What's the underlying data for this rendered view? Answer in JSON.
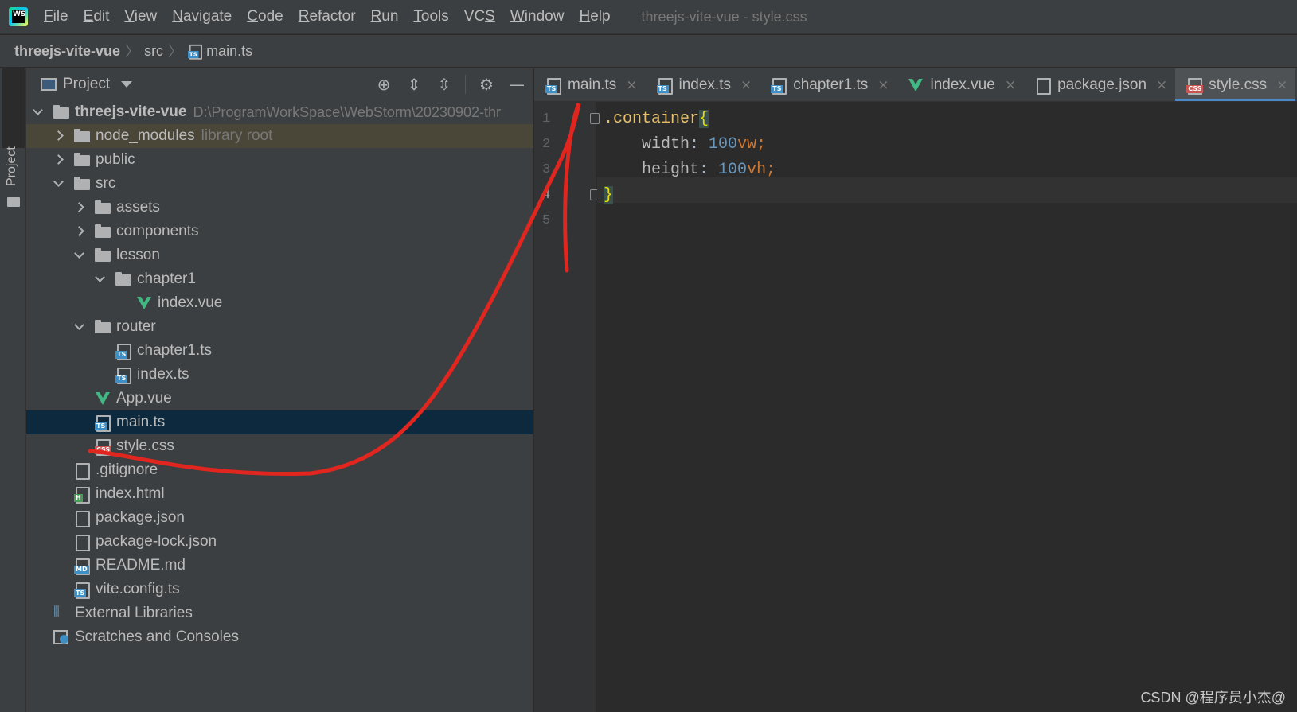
{
  "menubar": {
    "app_logo": "WS",
    "items": [
      {
        "pre": "",
        "u": "F",
        "post": "ile"
      },
      {
        "pre": "",
        "u": "E",
        "post": "dit"
      },
      {
        "pre": "",
        "u": "V",
        "post": "iew"
      },
      {
        "pre": "",
        "u": "N",
        "post": "avigate"
      },
      {
        "pre": "",
        "u": "C",
        "post": "ode"
      },
      {
        "pre": "",
        "u": "R",
        "post": "efactor"
      },
      {
        "pre": "",
        "u": "R",
        "post": "un"
      },
      {
        "pre": "",
        "u": "T",
        "post": "ools"
      },
      {
        "pre": "VC",
        "u": "S",
        "post": ""
      },
      {
        "pre": "",
        "u": "W",
        "post": "indow"
      },
      {
        "pre": "",
        "u": "H",
        "post": "elp"
      }
    ],
    "window_title": "threejs-vite-vue - style.css"
  },
  "breadcrumb": {
    "project": "threejs-vite-vue",
    "folder": "src",
    "file": "main.ts"
  },
  "toolstrip": {
    "project_label": "Project"
  },
  "project_panel": {
    "title": "Project",
    "tools": [
      "locate-icon",
      "expand-all-icon",
      "collapse-all-icon",
      "gear-icon",
      "minimize-icon"
    ],
    "tree": [
      {
        "label": "threejs-vite-vue",
        "extra": "D:\\ProgramWorkSpace\\WebStorm\\20230902-thr",
        "icon": "folder",
        "indent": 0,
        "chev": "down",
        "root": true
      },
      {
        "label": "node_modules",
        "extra": "library root",
        "icon": "folder",
        "indent": 1,
        "chev": "right",
        "state": "excluded"
      },
      {
        "label": "public",
        "icon": "folder",
        "indent": 1,
        "chev": "right"
      },
      {
        "label": "src",
        "icon": "folder",
        "indent": 1,
        "chev": "down"
      },
      {
        "label": "assets",
        "icon": "folder",
        "indent": 2,
        "chev": "right"
      },
      {
        "label": "components",
        "icon": "folder",
        "indent": 2,
        "chev": "right"
      },
      {
        "label": "lesson",
        "icon": "folder",
        "indent": 2,
        "chev": "down"
      },
      {
        "label": "chapter1",
        "icon": "folder",
        "indent": 3,
        "chev": "down"
      },
      {
        "label": "index.vue",
        "icon": "vue",
        "indent": 4,
        "chev": "none"
      },
      {
        "label": "router",
        "icon": "folder",
        "indent": 2,
        "chev": "down"
      },
      {
        "label": "chapter1.ts",
        "icon": "ts",
        "indent": 3,
        "chev": "none"
      },
      {
        "label": "index.ts",
        "icon": "ts",
        "indent": 3,
        "chev": "none"
      },
      {
        "label": "App.vue",
        "icon": "vue",
        "indent": 2,
        "chev": "none"
      },
      {
        "label": "main.ts",
        "icon": "ts",
        "indent": 2,
        "chev": "none",
        "state": "selected"
      },
      {
        "label": "style.css",
        "icon": "css",
        "indent": 2,
        "chev": "none"
      },
      {
        "label": ".gitignore",
        "icon": "file",
        "indent": 1,
        "chev": "none"
      },
      {
        "label": "index.html",
        "icon": "html",
        "indent": 1,
        "chev": "none"
      },
      {
        "label": "package.json",
        "icon": "file",
        "indent": 1,
        "chev": "none"
      },
      {
        "label": "package-lock.json",
        "icon": "file",
        "indent": 1,
        "chev": "none"
      },
      {
        "label": "README.md",
        "icon": "md",
        "indent": 1,
        "chev": "none"
      },
      {
        "label": "vite.config.ts",
        "icon": "ts",
        "indent": 1,
        "chev": "none"
      },
      {
        "label": "External Libraries",
        "icon": "libs",
        "indent": 0,
        "chev": "none"
      },
      {
        "label": "Scratches and Consoles",
        "icon": "scratch",
        "indent": 0,
        "chev": "none"
      }
    ]
  },
  "editor": {
    "tabs": [
      {
        "label": "main.ts",
        "icon": "ts"
      },
      {
        "label": "index.ts",
        "icon": "ts"
      },
      {
        "label": "chapter1.ts",
        "icon": "ts"
      },
      {
        "label": "index.vue",
        "icon": "vue"
      },
      {
        "label": "package.json",
        "icon": "file"
      },
      {
        "label": "style.css",
        "icon": "css",
        "active": true
      }
    ],
    "close_glyph": "×",
    "line_numbers": [
      "1",
      "2",
      "3",
      "4",
      "5"
    ],
    "current_line": 4,
    "code": {
      "selector": ".container",
      "open_brace": "{",
      "prop1": "width",
      "val1_num": "100",
      "val1_unit": "vw",
      "prop2": "height",
      "val2_num": "100",
      "val2_unit": "vh",
      "close_brace": "}"
    }
  },
  "watermark": "CSDN @程序员小杰@",
  "colors": {
    "accent": "#4a88c7",
    "vue": "#41b883",
    "annotation": "#e0261f"
  }
}
